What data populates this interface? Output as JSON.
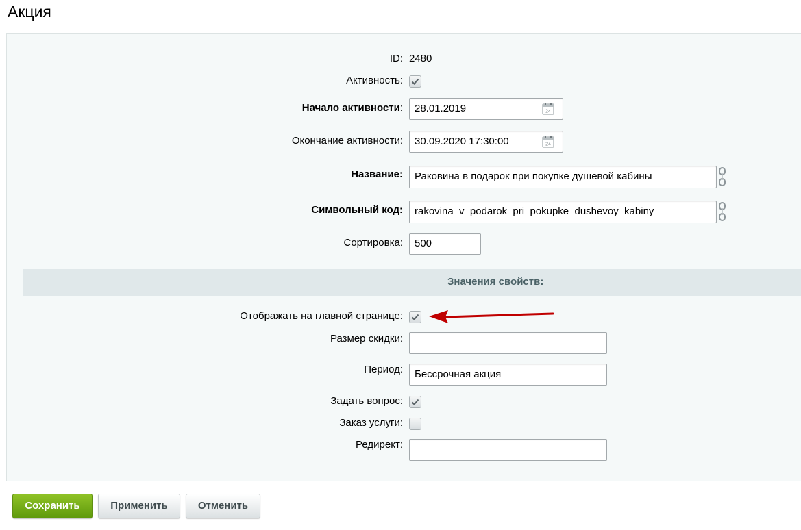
{
  "page": {
    "title": "Акция"
  },
  "fields": {
    "id": {
      "label": "ID:",
      "value": "2480"
    },
    "active": {
      "label": "Активность:",
      "checked": true
    },
    "active_from": {
      "label": "Начало активности",
      "label_suffix": ":",
      "value": "28.01.2019"
    },
    "active_to": {
      "label": "Окончание активности:",
      "value": "30.09.2020 17:30:00"
    },
    "name": {
      "label": "Название:",
      "value": "Раковина в подарок при покупке душевой кабины"
    },
    "code": {
      "label": "Символьный код:",
      "value": "rakovina_v_podarok_pri_pokupke_dushevoy_kabiny"
    },
    "sort": {
      "label": "Сортировка:",
      "value": "500"
    }
  },
  "properties": {
    "header": "Значения свойств:",
    "show_on_main": {
      "label": "Отображать на главной странице:",
      "checked": true
    },
    "discount_size": {
      "label": "Размер скидки:",
      "value": ""
    },
    "period": {
      "label": "Период:",
      "value": "Бессрочная акция"
    },
    "ask_question": {
      "label": "Задать вопрос:",
      "checked": true
    },
    "order_service": {
      "label": "Заказ услуги:",
      "checked": false
    },
    "redirect": {
      "label": "Редирект:",
      "value": ""
    }
  },
  "buttons": {
    "save": "Сохранить",
    "apply": "Применить",
    "cancel": "Отменить"
  },
  "icons": {
    "calendar": "calendar-icon",
    "link": "chain-link-icon",
    "arrow": "red-arrow-icon",
    "check": "checkmark-icon"
  },
  "colors": {
    "save_button": "#7ab21a",
    "section_band": "#e0e8ea",
    "panel": "#f5f9f9",
    "arrow": "#c00000"
  }
}
